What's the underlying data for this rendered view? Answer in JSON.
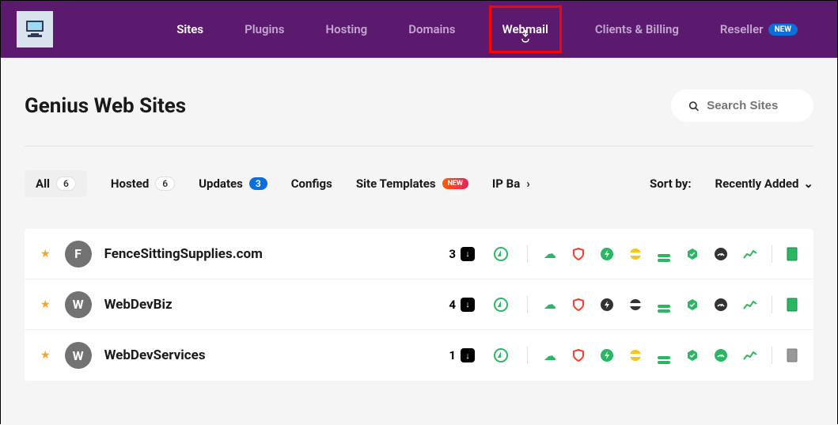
{
  "nav": {
    "items": [
      {
        "label": "Sites",
        "active": true
      },
      {
        "label": "Plugins"
      },
      {
        "label": "Hosting"
      },
      {
        "label": "Domains"
      },
      {
        "label": "Webmail",
        "highlighted": true
      },
      {
        "label": "Clients & Billing"
      },
      {
        "label": "Reseller",
        "badge": "NEW"
      }
    ]
  },
  "page": {
    "title": "Genius Web Sites",
    "search_placeholder": "Search Sites"
  },
  "filters": {
    "all": {
      "label": "All",
      "count": "6"
    },
    "hosted": {
      "label": "Hosted",
      "count": "6"
    },
    "updates": {
      "label": "Updates",
      "count": "3"
    },
    "configs": {
      "label": "Configs"
    },
    "templates": {
      "label": "Site Templates",
      "badge": "NEW"
    },
    "ipba": {
      "label": "IP Ba"
    },
    "sort_label": "Sort by:",
    "sort_value": "Recently Added"
  },
  "sites": [
    {
      "initial": "F",
      "name": "FenceSittingSupplies.com",
      "updates": "3"
    },
    {
      "initial": "W",
      "name": "WebDevBiz",
      "updates": "4"
    },
    {
      "initial": "W",
      "name": "WebDevServices",
      "updates": "1"
    }
  ],
  "colors": {
    "green": "#29b765",
    "red": "#ff3b30",
    "yellow": "#f5c518",
    "dark": "#333333",
    "purple_header": "#5b1a6e"
  }
}
